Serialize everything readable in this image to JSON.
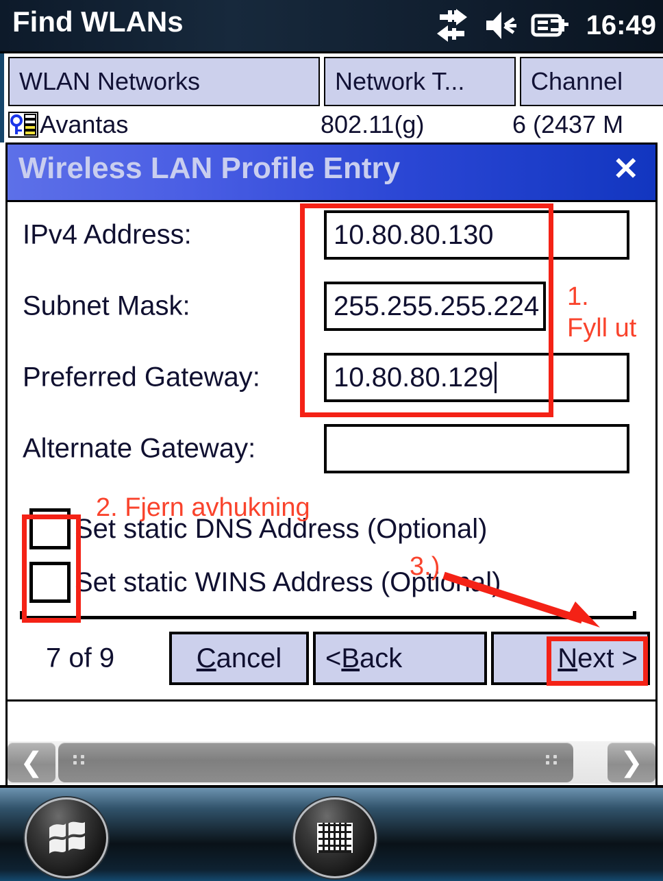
{
  "os_bar": {
    "title": "Find WLANs",
    "clock": "16:49",
    "icons": [
      "connectivity-arrows-icon",
      "speaker-mute-icon",
      "battery-charging-icon"
    ]
  },
  "network_list": {
    "columns": [
      "WLAN Networks",
      "Network T...",
      "Channel"
    ],
    "rows": [
      {
        "name": "Avantas",
        "type": "802.11(g)",
        "channel": "6 (2437 M",
        "icon": "secured-network-icon"
      }
    ]
  },
  "dialog": {
    "title": "Wireless LAN Profile Entry",
    "close_label": "✕",
    "fields": [
      {
        "label": "IPv4 Address:",
        "value": "10.80.80.130",
        "focused": false
      },
      {
        "label": "Subnet Mask:",
        "value": "255.255.255.224",
        "focused": false
      },
      {
        "label": "Preferred Gateway:",
        "value": "10.80.80.129",
        "focused": true
      },
      {
        "label": "Alternate Gateway:",
        "value": "",
        "focused": false
      }
    ],
    "checkboxes": [
      {
        "label": "Set static DNS Address (Optional)",
        "checked": false
      },
      {
        "label": "Set static WINS Address (Optional)",
        "checked": false
      }
    ],
    "footer": {
      "page_counter": "7 of 9",
      "buttons": [
        {
          "pre": "",
          "accel": "C",
          "post": "ancel"
        },
        {
          "pre": "< ",
          "accel": "B",
          "post": "ack"
        },
        {
          "pre": "",
          "accel": "N",
          "post": "ext >"
        }
      ]
    }
  },
  "scrollbar": {
    "left_arrow": "❮",
    "right_arrow": "❯"
  },
  "taskbar": {
    "start_label": "start-button",
    "keyboard_label": "keyboard-button"
  },
  "annotations": {
    "accent_color": "#f42216",
    "step1_number": "1.",
    "step1_text": "Fyll ut",
    "step2_text": "2. Fjern avhukning",
    "step3_text": "3.)"
  }
}
